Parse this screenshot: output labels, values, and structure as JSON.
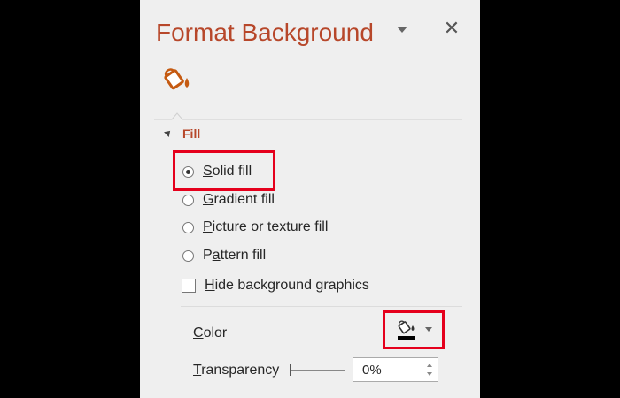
{
  "pane": {
    "title": "Format Background",
    "close_glyph": "✕",
    "icons": {
      "menu": "dropdown-arrow-icon",
      "close": "close-icon",
      "fill": "paint-bucket-fill-icon"
    }
  },
  "fill_section": {
    "title": "Fill",
    "options": [
      {
        "label": "Solid fill",
        "accel": "S",
        "rest": "olid fill",
        "selected": true
      },
      {
        "label": "Gradient fill",
        "accel": "G",
        "rest": "radient fill",
        "selected": false
      },
      {
        "label": "Picture or texture fill",
        "accel": "P",
        "rest": "icture or texture fill",
        "selected": false
      },
      {
        "label": "Pattern fill",
        "accel": "P",
        "pre": "P",
        "accel_mid": "a",
        "rest": "ttern fill",
        "selected": false
      }
    ],
    "hide_graphics": {
      "label": "Hide background graphics",
      "accel": "H",
      "rest": "ide background graphics",
      "checked": false
    }
  },
  "color": {
    "label": "Color",
    "accel": "C",
    "rest": "olor",
    "swatch": "#000000"
  },
  "transparency": {
    "label": "Transparency",
    "accel": "T",
    "rest": "ransparency",
    "value": "0%",
    "level": 0
  },
  "colors": {
    "accent": "#b7472a",
    "highlight": "#e5001c",
    "pane_bg": "#efefef"
  }
}
